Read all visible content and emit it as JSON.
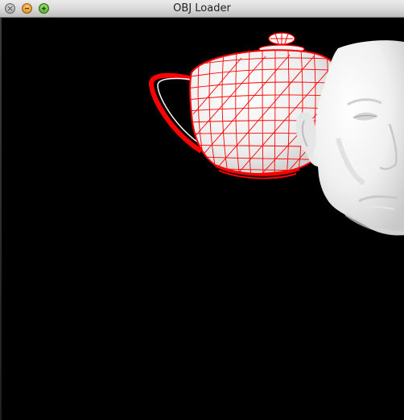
{
  "window": {
    "title": "OBJ Loader"
  },
  "titlebar_buttons": [
    {
      "name": "close",
      "icon": "close-icon"
    },
    {
      "name": "minimize",
      "icon": "minimize-icon"
    },
    {
      "name": "zoom",
      "icon": "zoom-plus-icon"
    }
  ],
  "scene": {
    "background": "#000000",
    "teapot_wire_color": "#ff0000",
    "teapot_fill_color": "#ffffff",
    "head_color": "#f2f2f2"
  }
}
